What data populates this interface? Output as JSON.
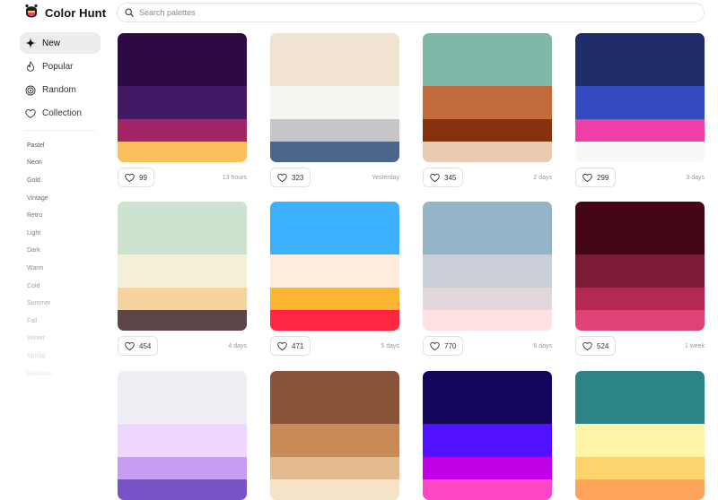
{
  "app": {
    "name": "Color Hunt"
  },
  "search": {
    "placeholder": "Search palettes"
  },
  "nav": [
    {
      "label": "New",
      "icon": "sparkle-icon",
      "active": true
    },
    {
      "label": "Popular",
      "icon": "flame-icon"
    },
    {
      "label": "Random",
      "icon": "spiral-icon"
    },
    {
      "label": "Collection",
      "icon": "heart-icon"
    }
  ],
  "tags": [
    "Pastel",
    "Neon",
    "Gold",
    "Vintage",
    "Retro",
    "Light",
    "Dark",
    "Warm",
    "Cold",
    "Summer",
    "Fall",
    "Winter",
    "Spring",
    "Rainbow"
  ],
  "palettes": [
    {
      "colors": [
        "#2E0A45",
        "#411964",
        "#A42468",
        "#FDC05E"
      ],
      "likes": "99",
      "time": "13 hours"
    },
    {
      "colors": [
        "#F0E4D1",
        "#F6F5F2",
        "#C8C5C8",
        "#4C6689"
      ],
      "likes": "323",
      "time": "Yesterday"
    },
    {
      "colors": [
        "#7FB8A9",
        "#C46B3B",
        "#86310E",
        "#EACBAF"
      ],
      "likes": "345",
      "time": "2 days"
    },
    {
      "colors": [
        "#1F2D69",
        "#334BBE",
        "#EE3FA6",
        "#F8F8F8"
      ],
      "likes": "299",
      "time": "3 days"
    },
    {
      "colors": [
        "#CDE3D0",
        "#F4EFD7",
        "#F7D39E",
        "#5D4548"
      ],
      "likes": "454",
      "time": "4 days"
    },
    {
      "colors": [
        "#3CB2FF",
        "#FFECDC",
        "#FBB532",
        "#FF2642"
      ],
      "likes": "471",
      "time": "5 days"
    },
    {
      "colors": [
        "#94B4C7",
        "#C9CED7",
        "#E4D7DA",
        "#FFE0E3"
      ],
      "likes": "770",
      "time": "6 days"
    },
    {
      "colors": [
        "#450718",
        "#7D1A38",
        "#B42952",
        "#DF4375"
      ],
      "likes": "524",
      "time": "1 week"
    },
    {
      "colors": [
        "#EFEEF5",
        "#EFD6FF",
        "#C69DF0",
        "#7A52C8"
      ],
      "likes": "",
      "time": ""
    },
    {
      "colors": [
        "#89543A",
        "#C88B58",
        "#E3BB8E",
        "#F5E2C8"
      ],
      "likes": "",
      "time": ""
    },
    {
      "colors": [
        "#16055D",
        "#5211FF",
        "#C100E5",
        "#FF47C6"
      ],
      "likes": "",
      "time": ""
    },
    {
      "colors": [
        "#2C8486",
        "#FEF5A7",
        "#FFD36B",
        "#FFA45B"
      ],
      "likes": "",
      "time": ""
    }
  ]
}
